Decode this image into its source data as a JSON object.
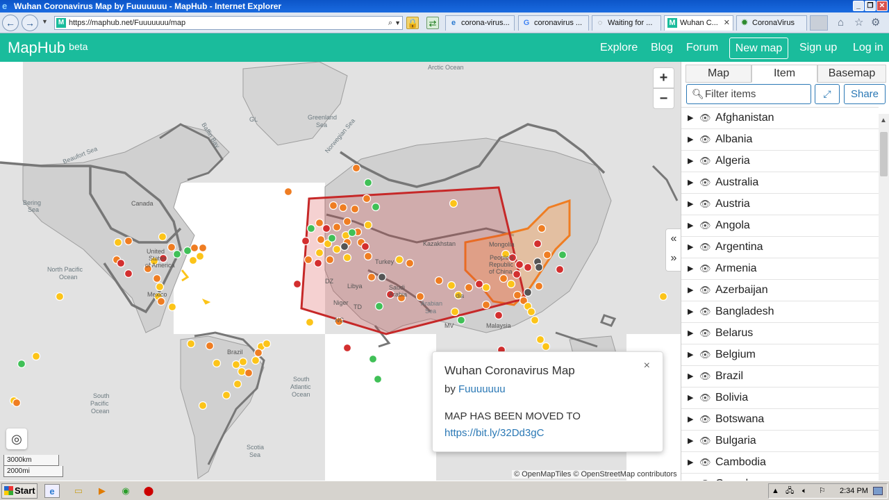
{
  "window": {
    "title": "Wuhan Coronavirus Map by Fuuuuuuu - MapHub - Internet Explorer"
  },
  "browser": {
    "url": "https://maphub.net/Fuuuuuuu/map",
    "tabs": [
      {
        "label": "corona-virus...",
        "icon": "ie-icon"
      },
      {
        "label": "coronavirus ...",
        "icon": "google-icon"
      },
      {
        "label": "Waiting for ...",
        "icon": "spinner-icon"
      },
      {
        "label": "Wuhan C...",
        "icon": "maphub-icon",
        "active": true
      },
      {
        "label": "CoronaVirus",
        "icon": "virus-icon"
      }
    ]
  },
  "header": {
    "logo": "MapHub",
    "logo_sup": "beta",
    "nav": {
      "explore": "Explore",
      "blog": "Blog",
      "forum": "Forum",
      "new_map": "New map",
      "signup": "Sign up",
      "login": "Log in"
    }
  },
  "map": {
    "zoom_in": "+",
    "zoom_out": "−",
    "scale_km": "3000km",
    "scale_mi": "2000mi",
    "attribution": "© OpenMapTiles © OpenStreetMap contributors",
    "labels": {
      "arctic": "Arctic Ocean",
      "gl": "GL",
      "greenland": "Greenland",
      "sea": "Sea",
      "beaufort": "Beaufort Sea",
      "baffin": "Baffin Bay",
      "bering": "Bering",
      "bering2": "Sea",
      "canada": "Canada",
      "united": "United",
      "states": "States",
      "ofamerica": "of America",
      "mexico": "Mexico",
      "npacific": "North Pacific",
      "ocean1": "Ocean",
      "brazil": "Brazil",
      "spacific": "South",
      "spacific2": "Pacific",
      "spacific3": "Ocean",
      "satlantic": "South",
      "satlantic2": "Atlantic",
      "satlantic3": "Ocean",
      "scotia": "Scotia",
      "scotia2": "Sea",
      "norwegian": "Norwegian Sea",
      "kazakhstan": "Kazakhstan",
      "mongolia": "Mongolia",
      "turkey": "Turkey",
      "libya": "Libya",
      "niger": "Niger",
      "td": "TD",
      "ng": "NG",
      "dz": "DZ",
      "saudi": "Saudi",
      "arabia": "Arabia",
      "arabiansea": "Arabian",
      "arabiansea2": "Sea",
      "people": "People's",
      "republic": "Republic",
      "ofchina": "of China",
      "mv": "MV",
      "malaysia": "Malaysia",
      "dia": "dia"
    }
  },
  "popup": {
    "title": "Wuhan Coronavirus Map",
    "by": "by",
    "author": "Fuuuuuuu",
    "message": "MAP HAS BEEN MOVED TO",
    "link": "https://bit.ly/32Dd3gC",
    "close": "×"
  },
  "panel": {
    "tabs": [
      "Map",
      "Item",
      "Basemap"
    ],
    "active_tab": "Item",
    "filter_placeholder": "Filter items",
    "share": "Share",
    "items": [
      "Afghanistan",
      "Albania",
      "Algeria",
      "Australia",
      "Austria",
      "Angola",
      "Argentina",
      "Armenia",
      "Azerbaijan",
      "Bangladesh",
      "Belarus",
      "Belgium",
      "Brazil",
      "Bolivia",
      "Botswana",
      "Bulgaria",
      "Cambodia",
      "Canada"
    ]
  },
  "taskbar": {
    "start": "Start",
    "clock": "2:34 PM"
  },
  "colors": {
    "accent": "#1abc9c",
    "red": "#d32f2f",
    "orange": "#ef7d22",
    "yellow": "#fcc419",
    "green": "#40c057",
    "gray": "#555555",
    "polygon": "#c62828",
    "link": "#2a78b5"
  }
}
